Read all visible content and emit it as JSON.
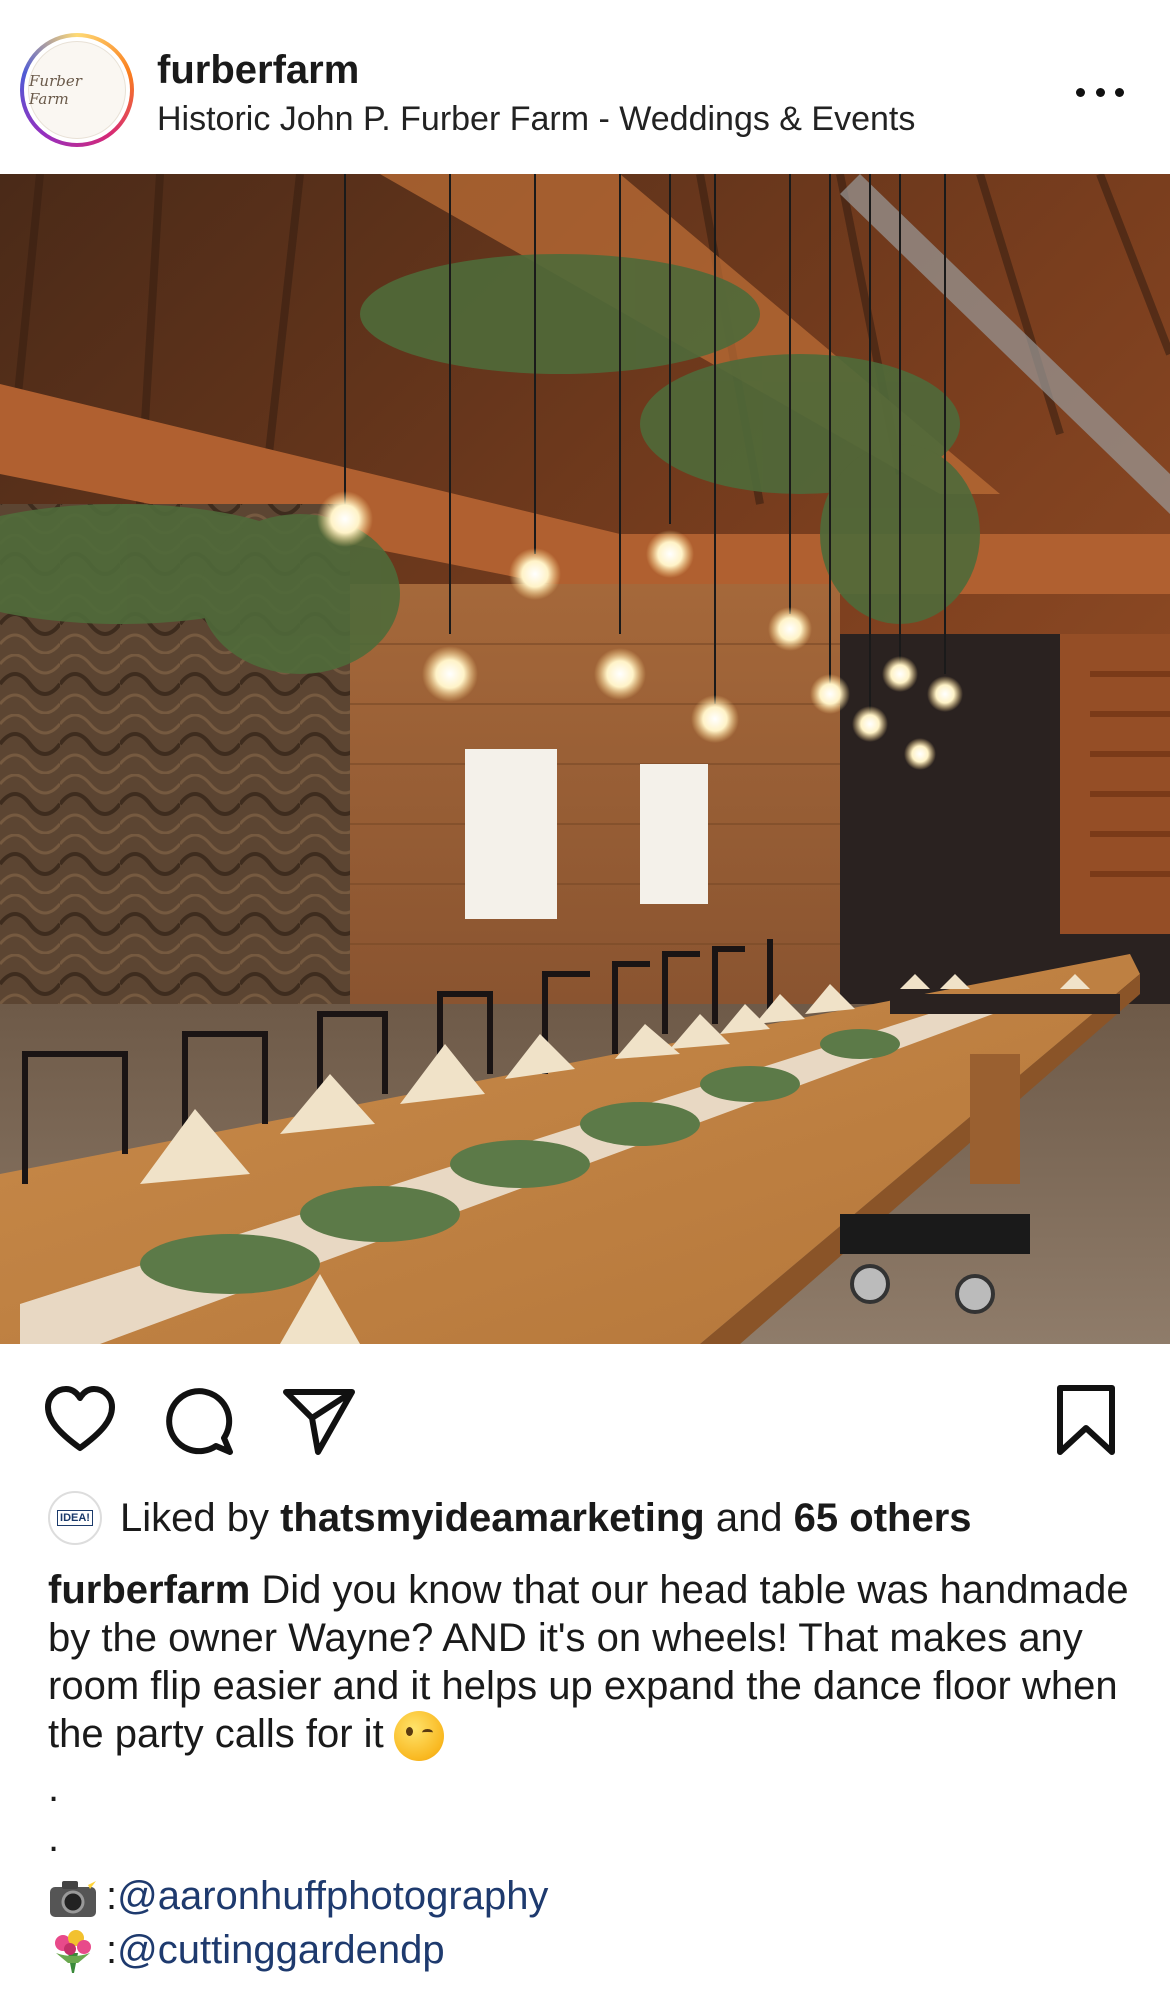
{
  "post": {
    "username": "furberfarm",
    "location": "Historic John P. Furber Farm - Weddings & Events",
    "avatar_text": "Furber Farm"
  },
  "likes": {
    "liker_avatar_text": "IDEA!",
    "prefix": "Liked by ",
    "liker": "thatsmyideamarketing",
    "mid": " and ",
    "count": "65 others"
  },
  "caption": {
    "user": "furberfarm",
    "text": " Did you know that our head table was handmade by the owner Wayne? AND it's on wheels! That makes any room flip easier and it helps up expand the dance floor when the party calls for it",
    "dot1": ".",
    "dot2": ".",
    "credit1_sep": ": ",
    "credit1_handle": "@aaronhuffphotography",
    "credit2_sep": ": ",
    "credit2_handle": "@cuttinggardendp"
  },
  "icons": {
    "more": "more-horizontal-icon",
    "like": "heart-icon",
    "comment": "comment-icon",
    "share": "send-icon",
    "save": "bookmark-icon",
    "wink": "winking-face-emoji",
    "camera": "camera-flash-emoji",
    "bouquet": "bouquet-emoji"
  }
}
